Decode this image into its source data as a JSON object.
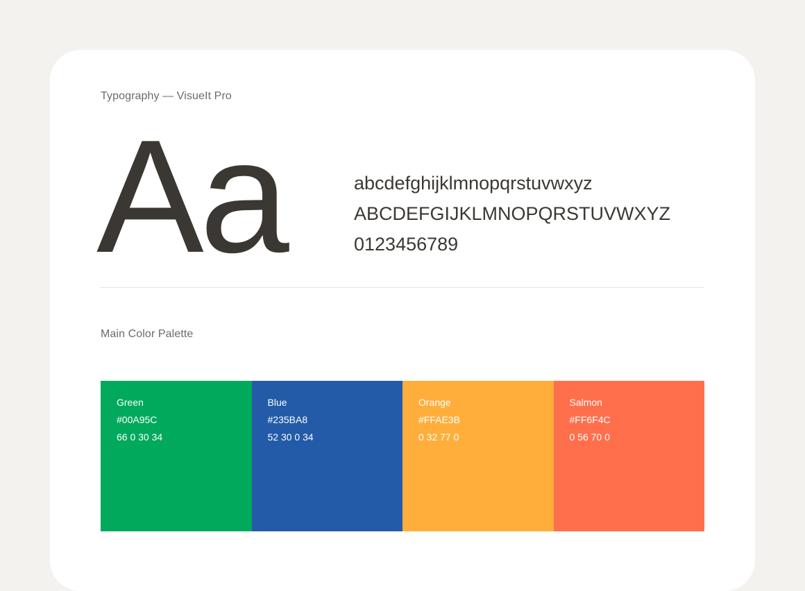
{
  "typography": {
    "title": "Typography  —  VisueIt Pro",
    "specimen": "Aa",
    "lowercase": "abcdefghijklmnopqrstuvwxyz",
    "uppercase": "ABCDEFGIJKLMNOPQRSTUVWXYZ",
    "digits": "0123456789"
  },
  "palette": {
    "title": "Main Color Palette",
    "swatches": [
      {
        "name": "Green",
        "hex": "#00A95C",
        "cmyk": "66  0  30  34",
        "color": "#00a95c"
      },
      {
        "name": "Blue",
        "hex": "#235BA8",
        "cmyk": "52 30 0 34",
        "color": "#235ba8"
      },
      {
        "name": "Orange",
        "hex": "#FFAE3B",
        "cmyk": "0 32 77 0",
        "color": "#ffae3b"
      },
      {
        "name": "Salmon",
        "hex": "#FF6F4C",
        "cmyk": "0 56 70 0",
        "color": "#ff6f4c"
      }
    ]
  },
  "colors": {
    "page_background": "#f3f2ee",
    "card_background": "#ffffff",
    "text_dark": "#3b3833",
    "text_muted": "#6e6a65"
  }
}
